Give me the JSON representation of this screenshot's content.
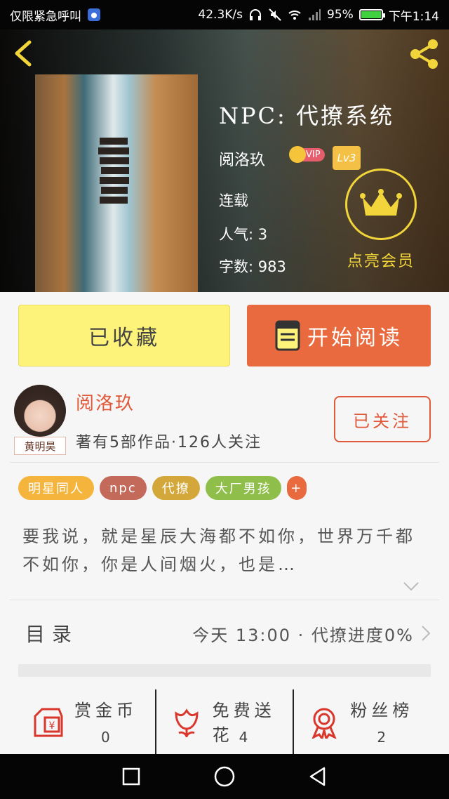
{
  "status_bar": {
    "left_text": "仅限紧急呼叫",
    "net_speed": "42.3K/s",
    "battery_pct": "95%",
    "time": "下午1:14",
    "battery_fill": 0.95
  },
  "book": {
    "title": "NPC: 代撩系统",
    "author": "阅洛玖",
    "vip_label": "VIP",
    "level": "Lv3",
    "status": "连载",
    "popularity": "人气: 3",
    "word_count": "字数: 983",
    "member_label": "点亮会员"
  },
  "actions": {
    "collect_label": "已收藏",
    "read_label": "开始阅读"
  },
  "author_card": {
    "avatar_tag": "黄明昊",
    "name": "阅洛玖",
    "works": "著有5部作品·126人关注",
    "follow_label": "已关注"
  },
  "tags": [
    {
      "label": "明星同人",
      "color": "#f5b53d"
    },
    {
      "label": "npc",
      "color": "#c36a5a"
    },
    {
      "label": "代撩",
      "color": "#d3a73a"
    },
    {
      "label": "大厂男孩",
      "color": "#8fbf4a"
    },
    {
      "label": "+",
      "color": "#e96a3e"
    }
  ],
  "intro": "要我说，就是星辰大海都不如你，世界万千都不如你，你是人间烟火，也是…",
  "toc": {
    "label": "目录",
    "status": "今天 13:00 · 代撩进度0%"
  },
  "stats": [
    {
      "label": "赏金币",
      "value": "0",
      "icon": "red-envelope-icon"
    },
    {
      "label": "免费送花",
      "value": "4",
      "icon": "flower-icon"
    },
    {
      "label": "粉丝榜",
      "value": "2",
      "icon": "medal-icon"
    }
  ],
  "colors": {
    "accent": "#e96a3e",
    "collect_bg": "#fdf27a",
    "gold": "#f1d53b"
  }
}
